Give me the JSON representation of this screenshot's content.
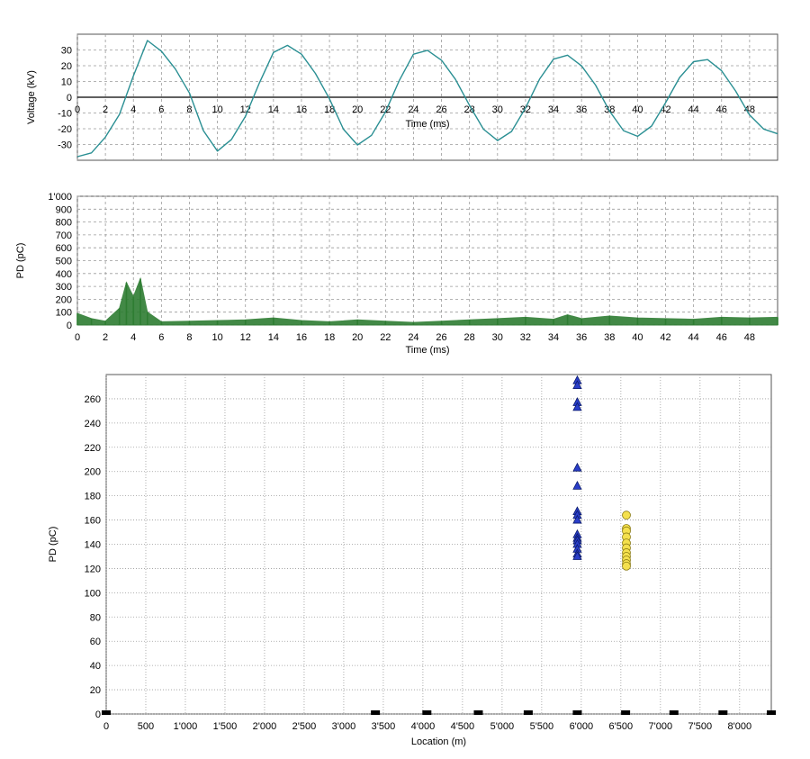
{
  "chart_data": [
    {
      "type": "line",
      "xlabel": "Time (ms)",
      "ylabel": "Voltage (kV)",
      "xlim": [
        0,
        50
      ],
      "ylim": [
        -40,
        40
      ],
      "x_ticks": [
        "0",
        "2",
        "4",
        "6",
        "8",
        "10",
        "12",
        "14",
        "16",
        "18",
        "20",
        "22",
        "24",
        "26",
        "28",
        "30",
        "32",
        "34",
        "36",
        "38",
        "40",
        "42",
        "44",
        "46",
        "48"
      ],
      "y_ticks": [
        "30",
        "20",
        "10",
        "0",
        "-10",
        "-20",
        "-30"
      ],
      "grid": true,
      "series": [
        {
          "color": "#2a8f93",
          "x": [
            0,
            1,
            2,
            3,
            4,
            5,
            6,
            7,
            8,
            9,
            10,
            11,
            12,
            13,
            14,
            15,
            16,
            17,
            18,
            19,
            20,
            21,
            22,
            23,
            24,
            25,
            26,
            27,
            28,
            29,
            30,
            31,
            32,
            33,
            34,
            35,
            36,
            37,
            38,
            39,
            40,
            41,
            42,
            43,
            44,
            45,
            46,
            47,
            48,
            49,
            50
          ],
          "values": [
            -37.7,
            -35.3,
            -25.3,
            -10.9,
            13.5,
            36.0,
            29.2,
            17.9,
            2.7,
            -21.2,
            -34.2,
            -26.8,
            -12.2,
            9.2,
            28.4,
            32.9,
            27.3,
            15.1,
            -1.0,
            -20.3,
            -30.3,
            -24.2,
            -9.3,
            10.9,
            27.3,
            29.8,
            23.5,
            11.3,
            -5.2,
            -20.3,
            -27.5,
            -21.7,
            -6.8,
            11.5,
            24.2,
            26.7,
            19.9,
            7.7,
            -8.8,
            -21.2,
            -24.8,
            -18.3,
            -3.5,
            12.5,
            22.6,
            23.9,
            16.8,
            4.0,
            -11.3,
            -20.2,
            -23.2
          ]
        }
      ]
    },
    {
      "type": "bar",
      "xlabel": "Time (ms)",
      "ylabel": "PD (pC)",
      "xlim": [
        0,
        50
      ],
      "ylim": [
        0,
        1000
      ],
      "x_ticks": [
        "0",
        "2",
        "4",
        "6",
        "8",
        "10",
        "12",
        "14",
        "16",
        "18",
        "20",
        "22",
        "24",
        "26",
        "28",
        "30",
        "32",
        "34",
        "36",
        "38",
        "40",
        "42",
        "44",
        "46",
        "48"
      ],
      "y_ticks": [
        "1'000",
        "900",
        "800",
        "700",
        "600",
        "500",
        "400",
        "300",
        "200",
        "100",
        "0"
      ],
      "grid": true,
      "series": [
        {
          "color": "#2e7d32",
          "x": [
            0,
            1,
            2,
            3,
            3.5,
            4,
            4.5,
            5,
            6,
            8,
            10,
            12,
            14,
            16,
            18,
            20,
            22,
            24,
            26,
            28,
            30,
            32,
            34,
            35,
            36,
            38,
            40,
            42,
            44,
            46,
            48,
            50
          ],
          "values": [
            90,
            50,
            30,
            130,
            330,
            220,
            360,
            100,
            25,
            30,
            35,
            40,
            55,
            35,
            25,
            40,
            30,
            20,
            30,
            40,
            50,
            60,
            45,
            80,
            50,
            70,
            55,
            50,
            45,
            60,
            55,
            60
          ]
        }
      ]
    },
    {
      "type": "scatter",
      "xlabel": "Location (m)",
      "ylabel": "PD (pC)",
      "xlim": [
        0,
        8400
      ],
      "ylim": [
        0,
        280
      ],
      "x_ticks": [
        "0",
        "500",
        "1'000",
        "1'500",
        "2'000",
        "2'500",
        "3'000",
        "3'500",
        "4'000",
        "4'500",
        "5'000",
        "5'500",
        "6'000",
        "6'500",
        "7'000",
        "7'500",
        "8'000"
      ],
      "y_ticks": [
        "260",
        "240",
        "220",
        "200",
        "180",
        "160",
        "140",
        "120",
        "100",
        "80",
        "60",
        "40",
        "20",
        "0"
      ],
      "grid": true,
      "markers_on_axis": [
        0,
        3400,
        4050,
        4700,
        5330,
        5950,
        6560,
        7170,
        7790,
        8400
      ],
      "series": [
        {
          "marker": "triangle",
          "color": "#2a3ec9",
          "x": [
            5950,
            5950,
            5950,
            5950,
            5950,
            5950,
            5950,
            5950,
            5950,
            5950,
            5950,
            5950,
            5950,
            5950,
            5950,
            5950
          ],
          "values": [
            275,
            271,
            257,
            253,
            203,
            188,
            167,
            164,
            160,
            148,
            145,
            143,
            140,
            136,
            132,
            130
          ]
        },
        {
          "marker": "circle",
          "color": "#f4e04d",
          "x": [
            6570,
            6570,
            6570,
            6570,
            6570,
            6570,
            6570,
            6570,
            6570,
            6570,
            6570
          ],
          "values": [
            164,
            153,
            151,
            146,
            141,
            137,
            133,
            130,
            127,
            124,
            122
          ]
        }
      ]
    }
  ]
}
